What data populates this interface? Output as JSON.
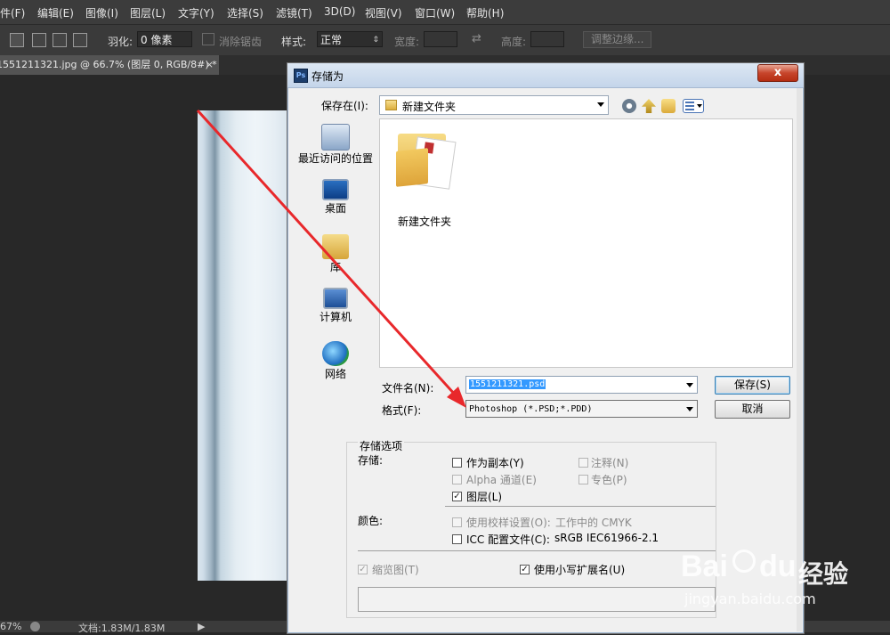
{
  "menubar": {
    "items": [
      "件(F)",
      "编辑(E)",
      "图像(I)",
      "图层(L)",
      "文字(Y)",
      "选择(S)",
      "滤镜(T)",
      "3D(D)",
      "视图(V)",
      "窗口(W)",
      "帮助(H)"
    ]
  },
  "options_bar": {
    "feather_label": "羽化:",
    "feather_value": "0 像素",
    "antialias_label": "消除锯齿",
    "style_label": "样式:",
    "style_value": "正常",
    "width_label": "宽度:",
    "height_label": "高度:",
    "refine_edge": "调整边缘..."
  },
  "document_tab": {
    "title": "1551211321.jpg @ 66.7% (图层 0, RGB/8#) *",
    "close": "×"
  },
  "status_bar": {
    "zoom": "67%",
    "doc_info": "文档:1.83M/1.83M"
  },
  "dialog": {
    "icon": "Ps",
    "title": "存储为",
    "close": "x",
    "save_in_label": "保存在(I):",
    "save_in_value": "新建文件夹",
    "places": [
      "最近访问的位置",
      "桌面",
      "库",
      "计算机",
      "网络"
    ],
    "files": [
      {
        "name": "新建文件夹"
      }
    ],
    "filename_label": "文件名(N):",
    "filename_value": "1551211321.psd",
    "format_label": "格式(F):",
    "format_value": "Photoshop (*.PSD;*.PDD)",
    "save_button": "保存(S)",
    "cancel_button": "取消",
    "options_group": "存储选项",
    "save_label": "存储:",
    "opt_copy": "作为副本(Y)",
    "opt_notes": "注释(N)",
    "opt_alpha": "Alpha 通道(E)",
    "opt_spot": "专色(P)",
    "opt_layers": "图层(L)",
    "color_label": "颜色:",
    "opt_proof": "使用校样设置(O):",
    "proof_profile": "工作中的 CMYK",
    "opt_icc": "ICC 配置文件(C):",
    "icc_profile": "sRGB IEC61966-2.1",
    "opt_thumbnail": "缩览图(T)",
    "opt_lowercase": "使用小写扩展名(U)",
    "checked": {
      "copy": false,
      "notes": false,
      "alpha": false,
      "spot": false,
      "layers": true,
      "proof": false,
      "icc": false,
      "thumbnail": true,
      "lowercase": true
    }
  },
  "watermark": {
    "brand": "Bai",
    "brand2": "du",
    "cn": "经验",
    "url": "jingyan.baidu.com"
  },
  "colors": {
    "annotation_arrow": "#e8282b",
    "ps_dark": "#282828",
    "dialog_bg": "#f0f0f0",
    "selection": "#3399ff"
  }
}
